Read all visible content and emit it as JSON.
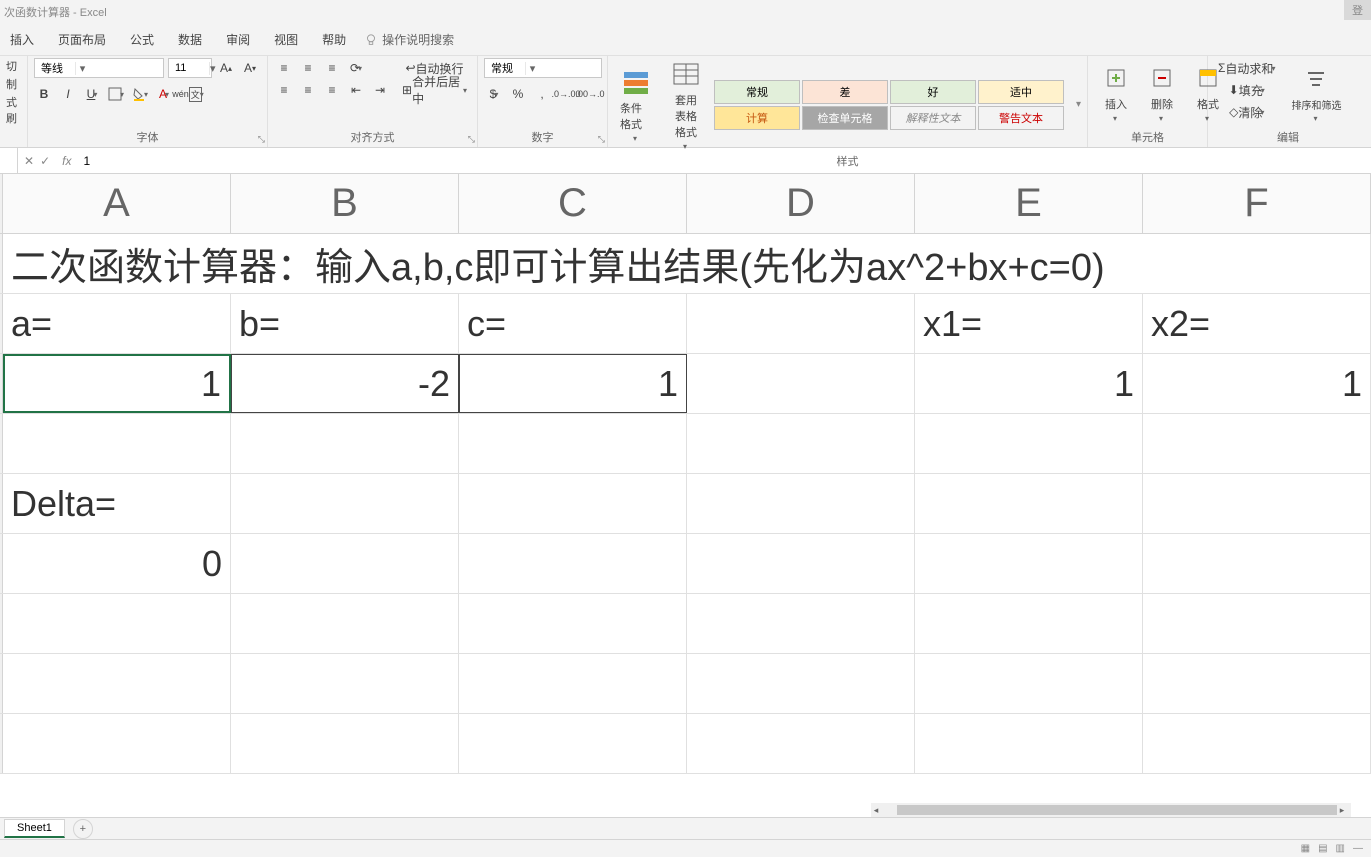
{
  "title": "次函数计算器  -  Excel",
  "login_btn": "登",
  "menu": {
    "insert": "插入",
    "layout": "页面布局",
    "formulas": "公式",
    "data": "数据",
    "review": "审阅",
    "view": "视图",
    "help": "帮助",
    "tell": "操作说明搜索"
  },
  "clipboard": {
    "cut": "切",
    "copy": "制",
    "painter": "式刷"
  },
  "font": {
    "name": "等线",
    "size": "11",
    "label": "字体"
  },
  "align": {
    "wrap": "自动换行",
    "merge": "合并后居中",
    "label": "对齐方式"
  },
  "number": {
    "fmt": "常规",
    "label": "数字"
  },
  "styles": {
    "condfmt": "条件格式",
    "tablefmt": "套用\n表格格式",
    "normal": "常规",
    "bad": "差",
    "good": "好",
    "neutral": "适中",
    "calc": "计算",
    "check": "检查单元格",
    "explain": "解释性文本",
    "warn": "警告文本",
    "label": "样式"
  },
  "cells": {
    "insert": "插入",
    "delete": "删除",
    "format": "格式",
    "label": "单元格"
  },
  "editing": {
    "autosum": "自动求和",
    "fill": "填充",
    "clear": "清除",
    "sortfilter": "排序和筛选",
    "label": "编辑"
  },
  "fx": {
    "value": "1"
  },
  "columns": [
    "A",
    "B",
    "C",
    "D",
    "E",
    "F"
  ],
  "cells_data": {
    "r1": "二次函数计算器：输入a,b,c即可计算出结果(先化为ax^2+bx+c=0)",
    "a_lbl": "a=",
    "b_lbl": "b=",
    "c_lbl": "c=",
    "x1_lbl": "x1=",
    "x2_lbl": "x2=",
    "a_val": "1",
    "b_val": "-2",
    "c_val": "1",
    "x1_val": "1",
    "x2_val": "1",
    "delta_lbl": "Delta=",
    "delta_val": "0"
  },
  "sheet_tab": "Sheet1"
}
